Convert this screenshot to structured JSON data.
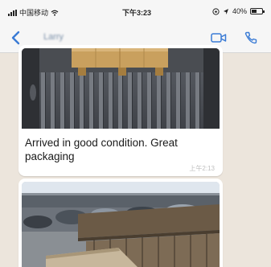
{
  "status_bar": {
    "carrier": "中国移动",
    "time": "下午3:23",
    "battery": "40%"
  },
  "nav": {
    "contact_name": "Larry"
  },
  "messages": [
    {
      "caption": "Arrived in good condition. Great packaging",
      "time": "上午2:13"
    },
    {
      "caption": ""
    }
  ],
  "colors": {
    "accent": "#3a7bd5",
    "chat_background": "#ece5dc"
  },
  "icons": [
    "wifi-icon",
    "location-icon",
    "back-icon",
    "video-call-icon",
    "phone-call-icon"
  ]
}
